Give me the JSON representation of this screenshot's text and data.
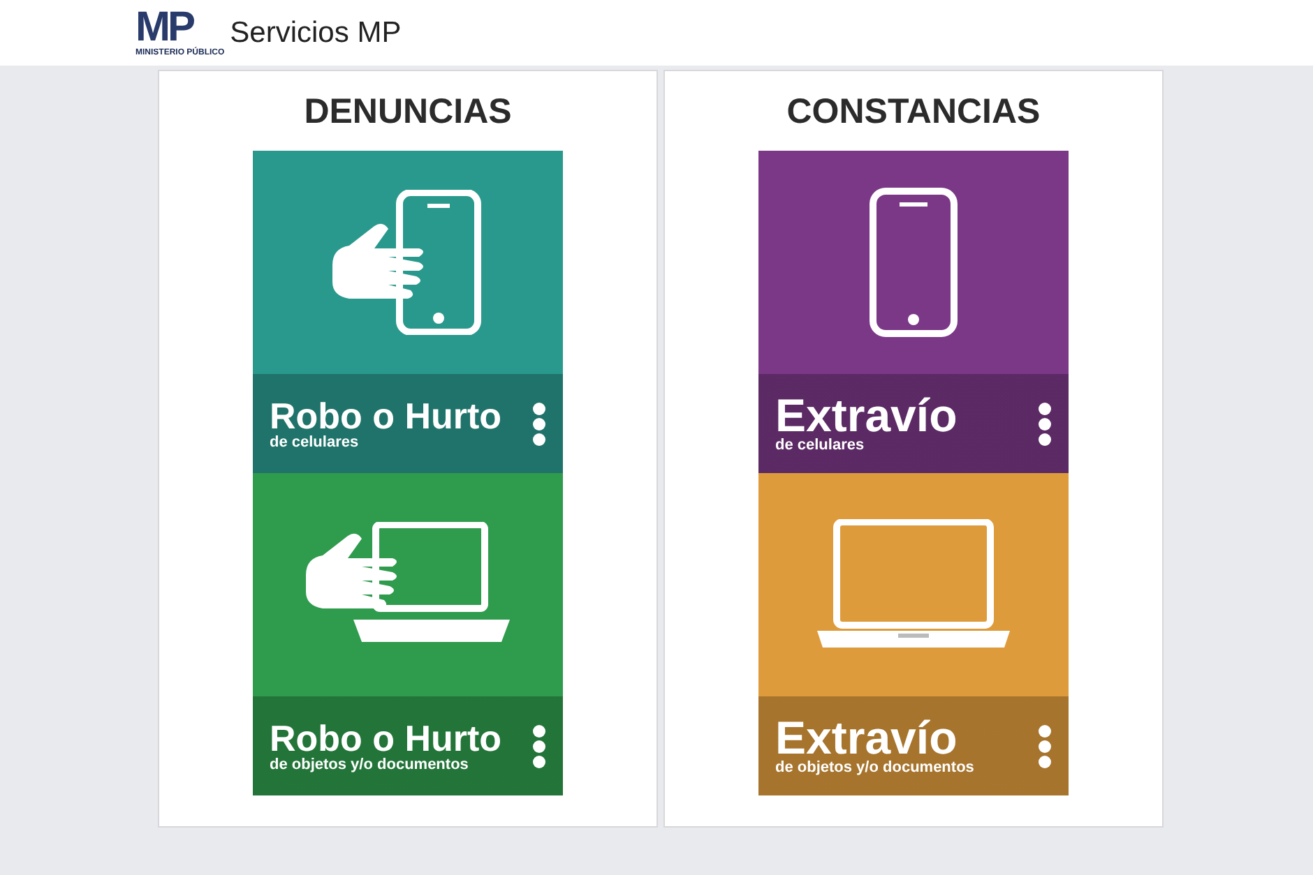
{
  "header": {
    "logo_text": "MP",
    "logo_subtext": "MINISTERIO PÚBLICO",
    "title": "Servicios MP"
  },
  "panels": [
    {
      "title": "DENUNCIAS",
      "tiles": [
        {
          "kind": "hand-phone",
          "title": "Robo o Hurto",
          "subtitle": "de celulares",
          "color": "#2a998d"
        },
        {
          "kind": "hand-laptop",
          "title": "Robo o Hurto",
          "subtitle": "de objetos y/o documentos",
          "color": "#2f9b4c"
        }
      ]
    },
    {
      "title": "CONSTANCIAS",
      "tiles": [
        {
          "kind": "phone",
          "title": "Extravío",
          "subtitle": "de celulares",
          "color": "#7a3886"
        },
        {
          "kind": "laptop",
          "title": "Extravío",
          "subtitle": "de objetos y/o documentos",
          "color": "#de9b3b"
        }
      ]
    }
  ]
}
